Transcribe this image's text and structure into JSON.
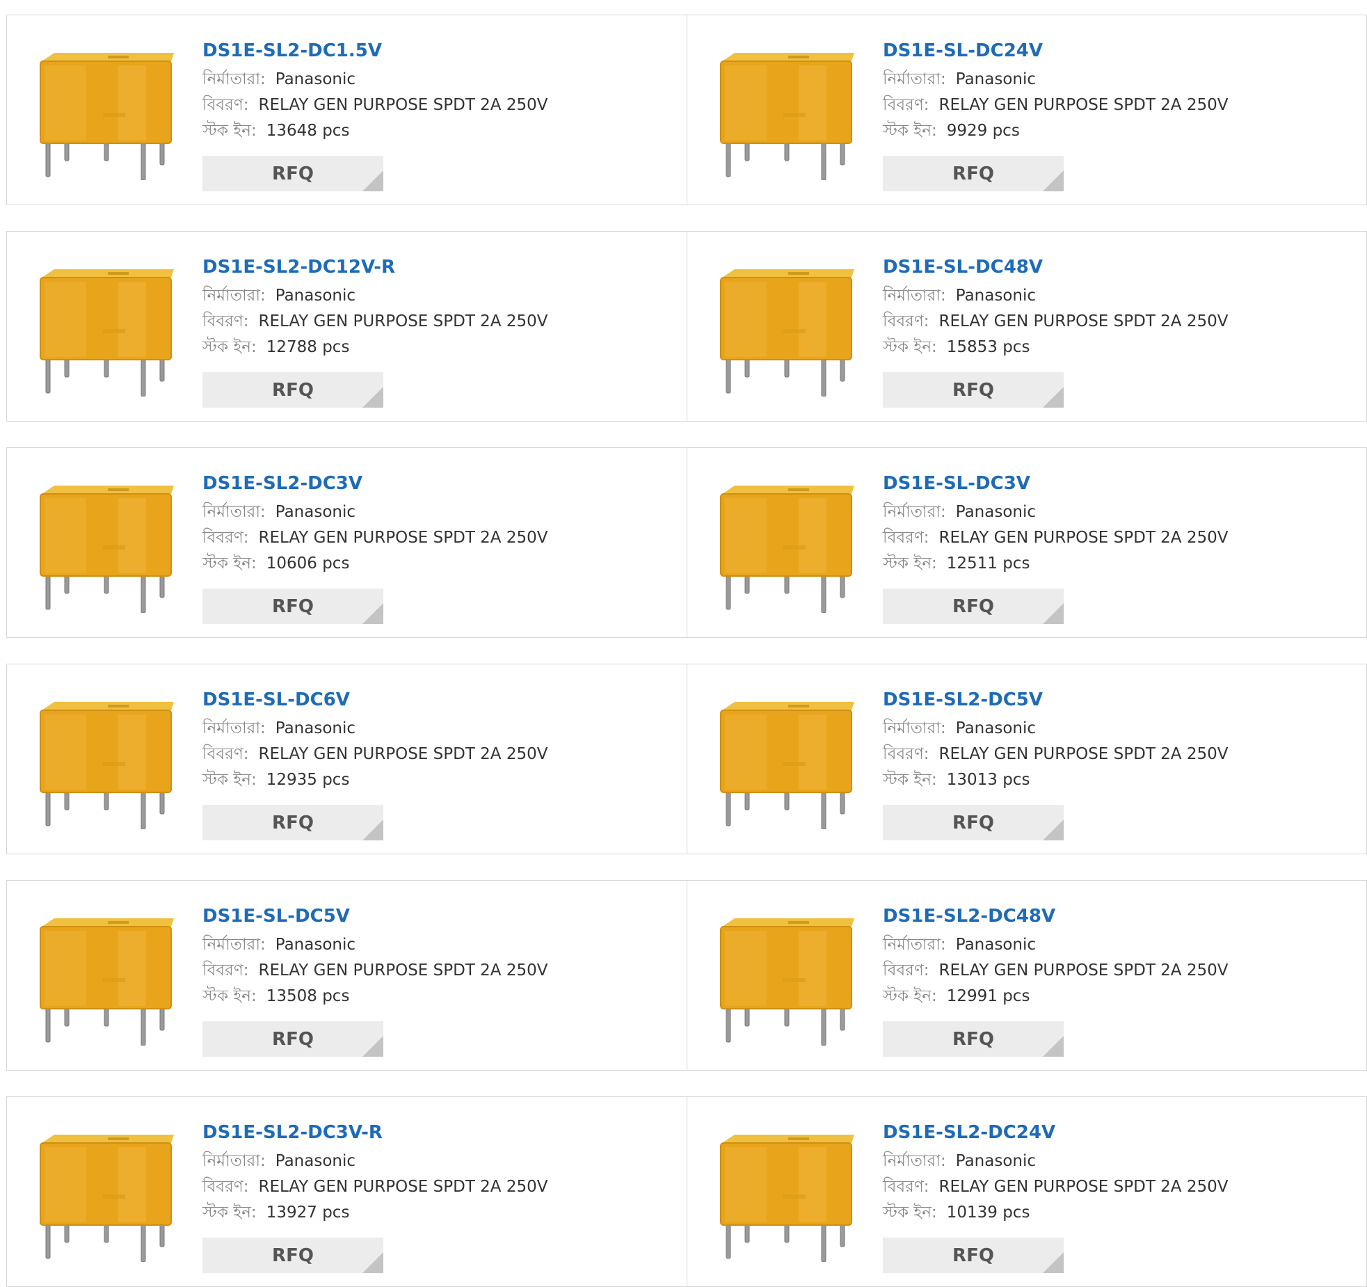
{
  "labels": {
    "manufacturer": "নির্মাতারা:",
    "description": "বিবরণ:",
    "stock": "স্টক ইন:",
    "rfq": "RFQ"
  },
  "colors": {
    "link": "#1e6bb8",
    "relay_body": "#e8a51c",
    "button_bg": "#ececec"
  },
  "image_icon": "relay-product-image",
  "rows": [
    [
      {
        "part": "DS1E-SL2-DC1.5V",
        "manufacturer": "Panasonic",
        "description": "RELAY GEN PURPOSE SPDT 2A 250V",
        "stock": "13648 pcs"
      },
      {
        "part": "DS1E-SL-DC24V",
        "manufacturer": "Panasonic",
        "description": "RELAY GEN PURPOSE SPDT 2A 250V",
        "stock": "9929 pcs"
      }
    ],
    [
      {
        "part": "DS1E-SL2-DC12V-R",
        "manufacturer": "Panasonic",
        "description": "RELAY GEN PURPOSE SPDT 2A 250V",
        "stock": "12788 pcs"
      },
      {
        "part": "DS1E-SL-DC48V",
        "manufacturer": "Panasonic",
        "description": "RELAY GEN PURPOSE SPDT 2A 250V",
        "stock": "15853 pcs"
      }
    ],
    [
      {
        "part": "DS1E-SL2-DC3V",
        "manufacturer": "Panasonic",
        "description": "RELAY GEN PURPOSE SPDT 2A 250V",
        "stock": "10606 pcs"
      },
      {
        "part": "DS1E-SL-DC3V",
        "manufacturer": "Panasonic",
        "description": "RELAY GEN PURPOSE SPDT 2A 250V",
        "stock": "12511 pcs"
      }
    ],
    [
      {
        "part": "DS1E-SL-DC6V",
        "manufacturer": "Panasonic",
        "description": "RELAY GEN PURPOSE SPDT 2A 250V",
        "stock": "12935 pcs"
      },
      {
        "part": "DS1E-SL2-DC5V",
        "manufacturer": "Panasonic",
        "description": "RELAY GEN PURPOSE SPDT 2A 250V",
        "stock": "13013 pcs"
      }
    ],
    [
      {
        "part": "DS1E-SL-DC5V",
        "manufacturer": "Panasonic",
        "description": "RELAY GEN PURPOSE SPDT 2A 250V",
        "stock": "13508 pcs"
      },
      {
        "part": "DS1E-SL2-DC48V",
        "manufacturer": "Panasonic",
        "description": "RELAY GEN PURPOSE SPDT 2A 250V",
        "stock": "12991 pcs"
      }
    ],
    [
      {
        "part": "DS1E-SL2-DC3V-R",
        "manufacturer": "Panasonic",
        "description": "RELAY GEN PURPOSE SPDT 2A 250V",
        "stock": "13927 pcs"
      },
      {
        "part": "DS1E-SL2-DC24V",
        "manufacturer": "Panasonic",
        "description": "RELAY GEN PURPOSE SPDT 2A 250V",
        "stock": "10139 pcs"
      }
    ]
  ]
}
